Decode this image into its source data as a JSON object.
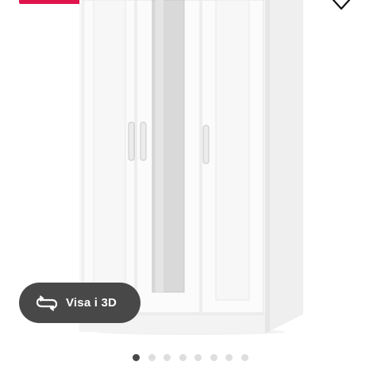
{
  "product": {
    "image_subject": "wardrobe-with-mirror-door"
  },
  "colors": {
    "promo": "#e0144c",
    "view3d_bg": "#484848",
    "dot_active": "#484848",
    "dot_inactive": "#dedede"
  },
  "icons": {
    "favourite": "heart-outline-icon",
    "view3d": "rotate-3d-icon"
  },
  "view3d_button": {
    "label": "Visa i 3D"
  },
  "carousel": {
    "total": 8,
    "active_index": 0
  }
}
